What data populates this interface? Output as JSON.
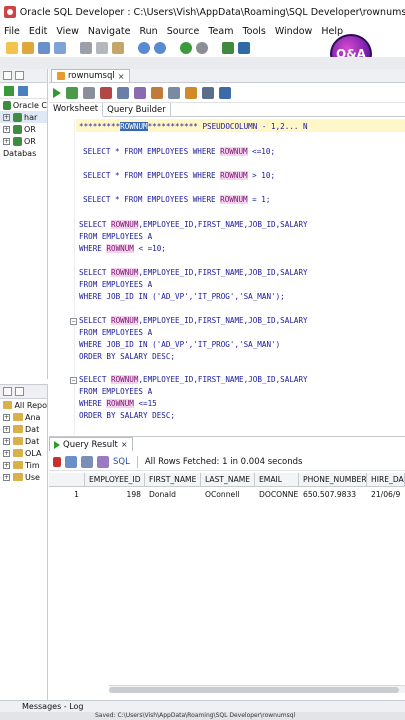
{
  "window": {
    "title": "Oracle SQL Developer : C:\\Users\\Vish\\AppData\\Roaming\\SQL Developer\\rownumsql"
  },
  "menu": [
    "File",
    "Edit",
    "View",
    "Navigate",
    "Run",
    "Source",
    "Team",
    "Tools",
    "Window",
    "Help"
  ],
  "logo_text": "Q&A",
  "connections": {
    "items": [
      "Oracle C",
      "har",
      "OR",
      "OR",
      "Databas"
    ]
  },
  "reports": {
    "items": [
      "All Repo",
      "Ana",
      "Dat",
      "Dat",
      "OLA",
      "Tim",
      "Use"
    ]
  },
  "editor": {
    "file_tab": "rownumsql",
    "sub_tabs": [
      "Worksheet",
      "Query Builder"
    ],
    "lines": {
      "l1a": "*********",
      "l1b": "ROWNUM",
      "l1c": "*********** PSEUDOCOLUMN - 1,2... N",
      "l2a": "SELECT * FROM EMPLOYEES WHERE ",
      "l2b": "ROWNUM",
      "l2c": " <=10;",
      "l3c": " > 10;",
      "l4c": " = 1;",
      "s1a": "SELECT ",
      "s1b": "ROWNUM",
      "s1c": ",EMPLOYEE_ID,FIRST_NAME,JOB_ID,SALARY",
      "from": "FROM EMPLOYEES A",
      "where1a": "WHERE ",
      "where1c": " < =10;",
      "where2": "WHERE JOB_ID IN ('AD_VP','IT_PROG','SA_MAN');",
      "where3": "WHERE JOB_ID IN ('AD_VP','IT_PROG','SA_MAN')",
      "order": "ORDER BY SALARY DESC;",
      "where4c": " <=15"
    }
  },
  "result": {
    "tab": "Query Result",
    "sql_label": "SQL",
    "status": "All Rows Fetched: 1 in 0.004 seconds",
    "columns": [
      "EMPLOYEE_ID",
      "FIRST_NAME",
      "LAST_NAME",
      "EMAIL",
      "PHONE_NUMBER",
      "HIRE_DA"
    ],
    "rows": [
      {
        "num": "1",
        "employee_id": "198",
        "first_name": "Donald",
        "last_name": "OConnell",
        "email": "DOCONNEL",
        "phone": "650.507.9833",
        "hire": "21/06/9"
      }
    ]
  },
  "bottom": {
    "messages": "Messages - Log",
    "status": "Saved: C:\\Users\\Vish\\AppData\\Roaming\\SQL Developer\\rownumsql"
  },
  "colors": {
    "keyword": "#1a1a9a",
    "rownum_highlight": "#f4d2f0",
    "selection": "#3869b4"
  }
}
